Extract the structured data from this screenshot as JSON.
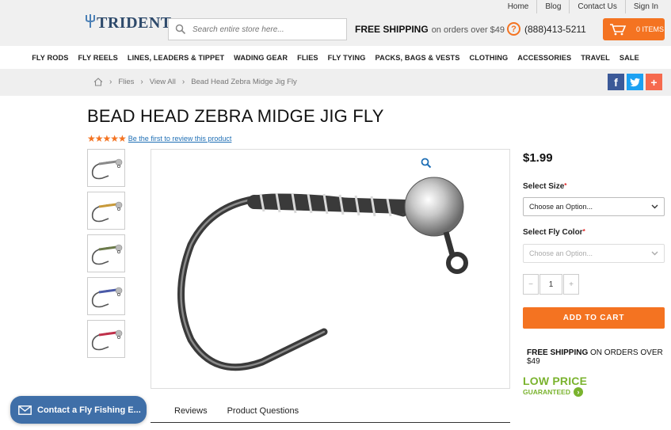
{
  "toplinks": [
    "Home",
    "Blog",
    "Contact Us",
    "Sign In"
  ],
  "logo": {
    "text": "TRIDENT"
  },
  "search": {
    "placeholder": "Search entire store here..."
  },
  "shipping_banner": {
    "strong": "FREE SHIPPING",
    "rest": "on orders over $49"
  },
  "phone": {
    "number": "(888)413-5211"
  },
  "cart": {
    "label": "0 ITEMS"
  },
  "nav": [
    "FLY RODS",
    "FLY REELS",
    "LINES, LEADERS & TIPPET",
    "WADING GEAR",
    "FLIES",
    "FLY TYING",
    "PACKS, BAGS & VESTS",
    "CLOTHING",
    "ACCESSORIES",
    "TRAVEL",
    "SALE"
  ],
  "breadcrumb": {
    "items": [
      "Flies",
      "View All",
      "Bead Head Zebra Midge Jig Fly"
    ]
  },
  "product": {
    "title": "BEAD HEAD ZEBRA MIDGE JIG FLY",
    "stars": "★★★★★",
    "review_link": "Be the first to review this product",
    "price": "$1.99",
    "size_label": "Select Size",
    "size_placeholder": "Choose an Option...",
    "color_label": "Select Fly Color",
    "color_placeholder": "Choose an Option...",
    "quantity": "1",
    "add_to_cart": "ADD TO CART",
    "free_ship_bold": "FREE SHIPPING",
    "free_ship_rest": "ON ORDERS OVER $49",
    "low_price": "LOW PRICE",
    "guaranteed": "GUARANTEED"
  },
  "thumb_colors": [
    "#8a8a8a",
    "#c89a3a",
    "#6b7a4a",
    "#4a5aa8",
    "#c0304a"
  ],
  "tabs": [
    "Reviews",
    "Product Questions"
  ],
  "contact": {
    "label": "Contact a Fly Fishing E..."
  },
  "colors": {
    "accent": "#f47321",
    "link": "#1f6fb5",
    "brand": "#2e4a6b",
    "green": "#7ab32e"
  }
}
